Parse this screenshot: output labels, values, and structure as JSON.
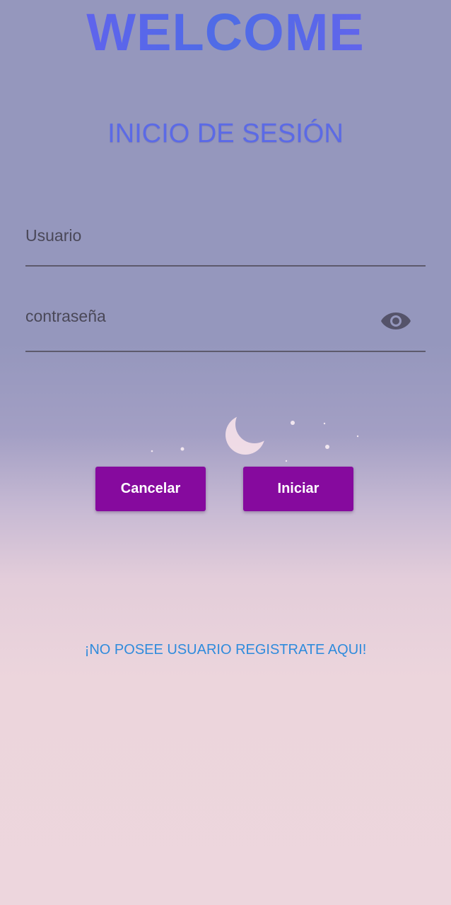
{
  "header": {
    "welcome": "WELCOME",
    "subtitle": "INICIO DE SESIÓN"
  },
  "form": {
    "username_placeholder": "Usuario",
    "username_value": "",
    "password_placeholder": "contraseña",
    "password_value": "",
    "visibility_icon": "eye-icon"
  },
  "buttons": {
    "cancel_label": "Cancelar",
    "start_label": "Iniciar"
  },
  "links": {
    "register_label": "¡NO POSEE USUARIO REGISTRATE AQUI!"
  },
  "colors": {
    "button_bg": "#860a9e",
    "title_gradient_start": "#6a5ef0",
    "title_gradient_end": "#4e6ce6",
    "link": "#2f8bdc"
  }
}
